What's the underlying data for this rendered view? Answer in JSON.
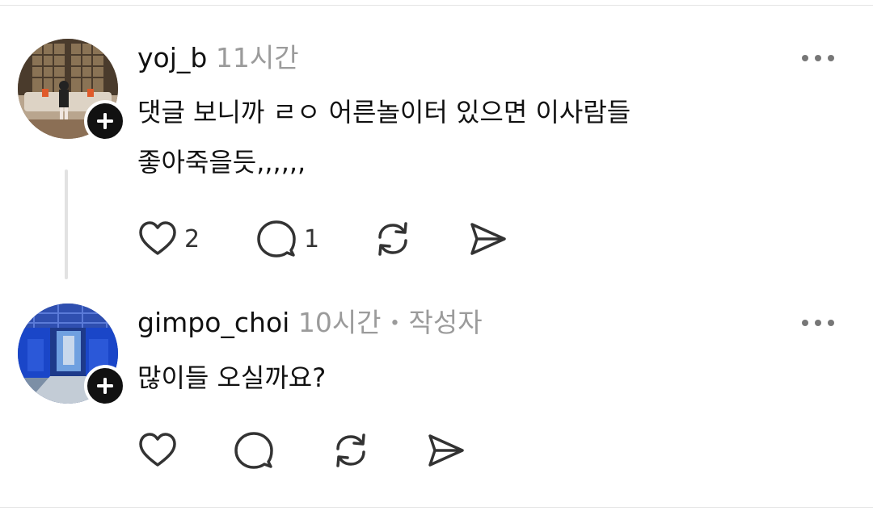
{
  "comments": [
    {
      "username": "yoj_b",
      "time": "11시간",
      "author_tag": "",
      "text_lines": [
        "댓글 보니까 ㄹㅇ 어른놀이터 있으면 이사람들",
        "좋아죽을듯,,,,,,"
      ],
      "likes": "2",
      "replies": "1",
      "avatar_icon": "profile-photo-lounge"
    },
    {
      "username": "gimpo_choi",
      "time": "10시간",
      "separator": "•",
      "author_tag": "작성자",
      "text_lines": [
        "많이들 오실까요?"
      ],
      "likes": "",
      "replies": "",
      "avatar_icon": "profile-photo-blue-corridor"
    }
  ],
  "icons": {
    "follow": "plus-icon",
    "like": "heart-icon",
    "reply": "comment-icon",
    "repost": "repost-icon",
    "share": "send-icon",
    "more": "more-icon"
  }
}
